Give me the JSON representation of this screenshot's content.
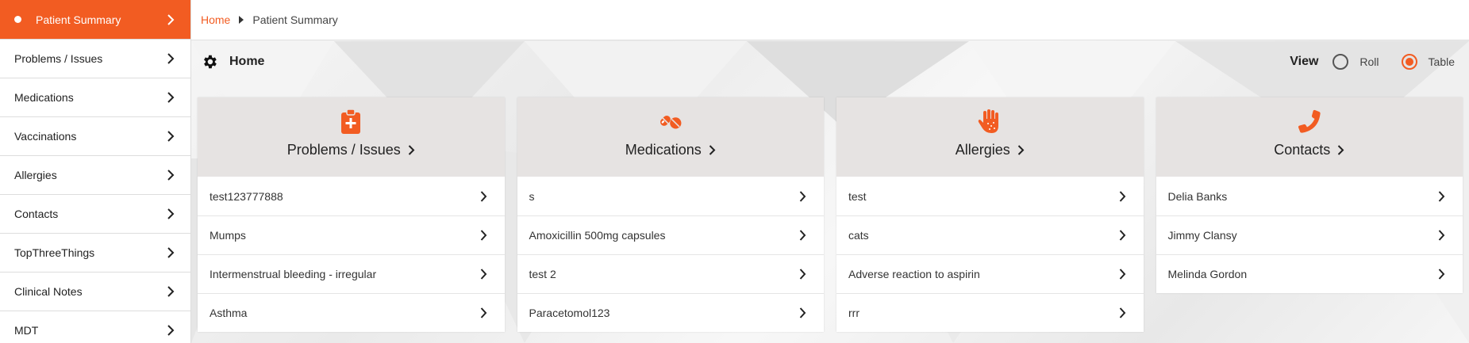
{
  "sidebar": {
    "items": [
      {
        "label": "Patient Summary",
        "active": true
      },
      {
        "label": "Problems / Issues"
      },
      {
        "label": "Medications"
      },
      {
        "label": "Vaccinations"
      },
      {
        "label": "Allergies"
      },
      {
        "label": "Contacts"
      },
      {
        "label": "TopThreeThings"
      },
      {
        "label": "Clinical Notes"
      },
      {
        "label": "MDT"
      }
    ]
  },
  "breadcrumb": {
    "home": "Home",
    "current": "Patient Summary"
  },
  "header": {
    "title": "Home",
    "icon": "gear-icon"
  },
  "view": {
    "label": "View",
    "options": [
      "Roll",
      "Table"
    ],
    "selected": "Table"
  },
  "colors": {
    "accent": "#f25c22",
    "card_head": "#e6e3e2"
  },
  "cards": [
    {
      "title": "Problems / Issues",
      "icon": "clipboard-plus-icon",
      "rows": [
        "test123777888",
        "Mumps",
        "Intermenstrual bleeding - irregular",
        "Asthma"
      ]
    },
    {
      "title": "Medications",
      "icon": "pills-icon",
      "rows": [
        "s",
        "Amoxicillin 500mg capsules",
        "test 2",
        "Paracetomol123"
      ]
    },
    {
      "title": "Allergies",
      "icon": "allergy-hand-icon",
      "rows": [
        "test",
        "cats",
        "Adverse reaction to aspirin",
        "rrr"
      ]
    },
    {
      "title": "Contacts",
      "icon": "phone-icon",
      "rows": [
        "Delia Banks",
        "Jimmy Clansy",
        "Melinda Gordon"
      ]
    }
  ]
}
